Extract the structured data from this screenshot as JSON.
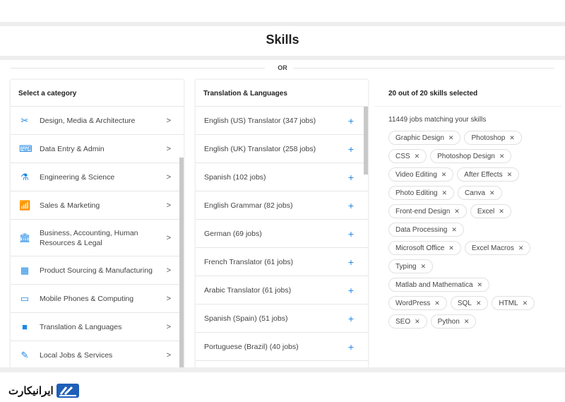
{
  "header": {
    "title": "Skills",
    "or_label": "OR"
  },
  "categories": {
    "heading": "Select a category",
    "items": [
      {
        "label": "Design, Media & Architecture",
        "icon": "tools-icon"
      },
      {
        "label": "Data Entry & Admin",
        "icon": "keyboard-icon"
      },
      {
        "label": "Engineering & Science",
        "icon": "flask-icon"
      },
      {
        "label": "Sales & Marketing",
        "icon": "chart-icon"
      },
      {
        "label": "Business, Accounting, Human Resources & Legal",
        "icon": "bank-icon"
      },
      {
        "label": "Product Sourcing & Manufacturing",
        "icon": "factory-icon"
      },
      {
        "label": "Mobile Phones & Computing",
        "icon": "devices-icon"
      },
      {
        "label": "Translation & Languages",
        "icon": "chat-icon"
      },
      {
        "label": "Local Jobs & Services",
        "icon": "brush-icon"
      }
    ]
  },
  "skills_list": {
    "heading": "Translation & Languages",
    "items": [
      "English (US) Translator (347 jobs)",
      "English (UK) Translator (258 jobs)",
      "Spanish (102 jobs)",
      "English Grammar (82 jobs)",
      "German (69 jobs)",
      "French Translator (61 jobs)",
      "Arabic Translator (61 jobs)",
      "Spanish (Spain) (51 jobs)",
      "Portuguese (Brazil) (40 jobs)"
    ]
  },
  "selected": {
    "heading": "20 out of 20 skills selected",
    "match_text": "11449 jobs matching your skills",
    "chips": [
      "Graphic Design",
      "Photoshop",
      "CSS",
      "Photoshop Design",
      "Video Editing",
      "After Effects",
      "Photo Editing",
      "Canva",
      "Front-end Design",
      "Excel",
      "Data Processing",
      "Microsoft Office",
      "Excel Macros",
      "Typing",
      "Matlab and Mathematica",
      "WordPress",
      "SQL",
      "HTML",
      "SEO",
      "Python"
    ]
  },
  "footer": {
    "logo_text": "ایرانیکارت"
  },
  "colors": {
    "accent": "#1e88e5"
  }
}
